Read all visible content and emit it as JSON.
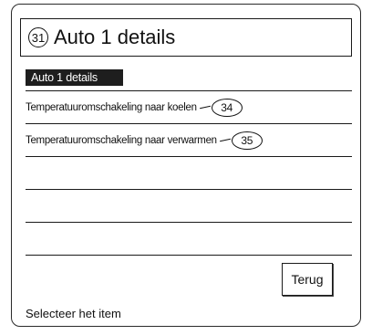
{
  "title": {
    "number": "31",
    "text": "Auto 1 details"
  },
  "screen": {
    "header": "Auto 1 details",
    "rows": [
      {
        "label": "Temperatuuromschakeling naar koelen",
        "callout": "34"
      },
      {
        "label": "Temperatuuromschakeling naar verwarmen",
        "callout": "35"
      },
      {
        "label": "",
        "callout": ""
      },
      {
        "label": "",
        "callout": ""
      },
      {
        "label": "",
        "callout": ""
      }
    ],
    "back_label": "Terug",
    "status": "Selecteer het item"
  }
}
